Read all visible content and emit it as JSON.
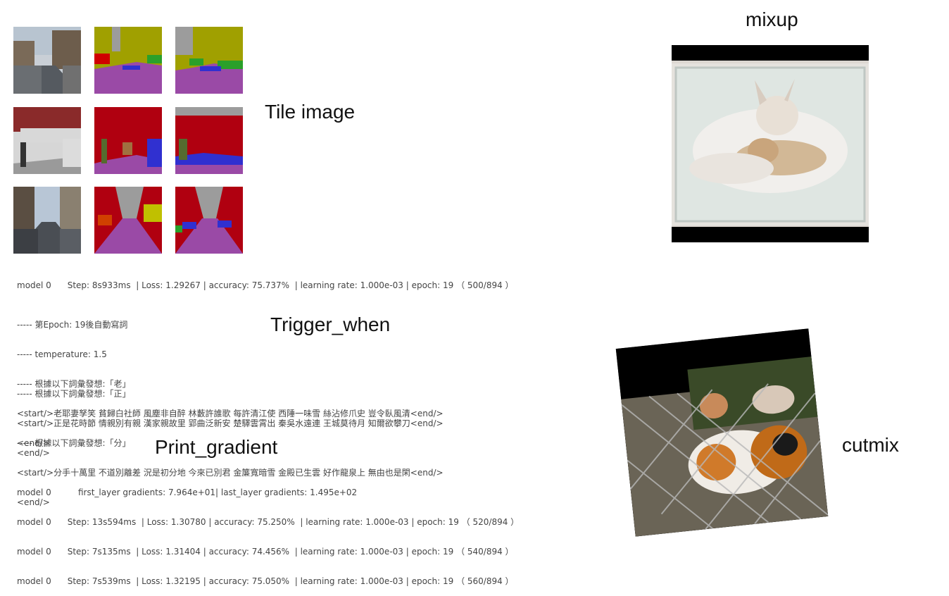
{
  "labels": {
    "tile_image": "Tile image",
    "mixup": "mixup",
    "trigger_when": "Trigger_when",
    "print_gradient": "Print_gradient",
    "cutmix": "cutmix"
  },
  "log": {
    "line1": "model 0      Step: 8s933ms  | Loss: 1.29267 | accuracy: 75.737%  | learning rate: 1.000e-03 | epoch: 19 （ 500/894 ）",
    "block1": [
      "----- 第Epoch: 19後自動寫詞",
      "----- temperature: 1.5",
      "----- 根據以下詞彙發想:「老」",
      "<start/>老耶妻孥笑 貧歸白社師 風塵非自醉 林藪許誰歌 每許清江使 西陲一味雪 絲沾修爪史 豈令臥風清<end/>",
      "<end/>"
    ],
    "block2": [
      "----- 根據以下詞彙發想:「正」",
      "<start/>正是花時節 情親別有親 漢家親故里 郢曲泛新安 楚驛雲霄出 秦吳水遠連 王城莫待月 知爾欲攀刀<end/>",
      "<end/>"
    ],
    "block3": [
      "----- 根據以下詞彙發想:「分」",
      "<start/>分手十萬里 不道別離差 況是初分地 今來已別君 金簾寬暗雪 金殿已生雲 好作龍泉上 無由也是閑<end/>",
      "<end/>"
    ],
    "block4": [
      "model 0          first_layer gradients: 7.964e+01| last_layer gradients: 1.495e+02",
      "model 0      Step: 13s594ms  | Loss: 1.30780 | accuracy: 75.250%  | learning rate: 1.000e-03 | epoch: 19 （ 520/894 ）",
      "model 0      Step: 7s135ms  | Loss: 1.31404 | accuracy: 74.456%  | learning rate: 1.000e-03 | epoch: 19 （ 540/894 ）",
      "model 0      Step: 7s539ms  | Loss: 1.32195 | accuracy: 75.050%  | learning rate: 1.000e-03 | epoch: 19 （ 560/894 ）"
    ]
  },
  "colors": {
    "seg_sky": "#9c9c9c",
    "seg_building": "#a0a000",
    "seg_road": "#9a4aa6",
    "seg_vegetation": "#2aa02a",
    "seg_car": "#3030d0",
    "seg_wall": "#b00010"
  }
}
